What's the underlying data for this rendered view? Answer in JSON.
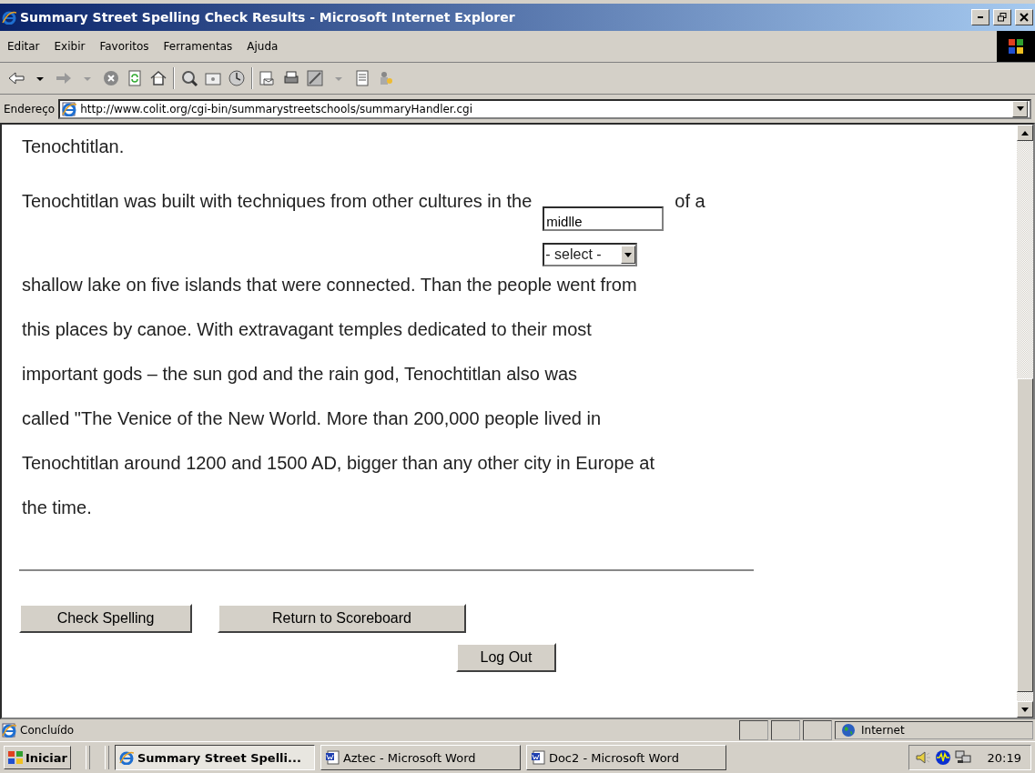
{
  "window": {
    "title": "Summary Street Spelling Check Results - Microsoft Internet Explorer"
  },
  "menu": [
    "Editar",
    "Exibir",
    "Favoritos",
    "Ferramentas",
    "Ajuda"
  ],
  "address": {
    "label": "Endereço",
    "url": "http://www.colit.org/cgi-bin/summarystreetschools/summaryHandler.cgi"
  },
  "page": {
    "lines_before": [
      "Tenochtitlan."
    ],
    "field_line": {
      "before": "Tenochtitlan was built with techniques from other cultures in the",
      "value": "midlle",
      "after": "of a"
    },
    "select": "- select -",
    "lines_after": [
      "shallow lake on five islands that were connected. Than the people went from",
      "this places by canoe. With extravagant temples dedicated to their most",
      "important gods – the sun god and the rain god, Tenochtitlan also was",
      "called \"The Venice of the New World. More than 200,000 people lived in",
      "Tenochtitlan around 1200 and 1500 AD, bigger than any other city in Europe at",
      "the time."
    ],
    "buttons": [
      "Check Spelling",
      "Return to Scoreboard"
    ],
    "logout": "Log Out"
  },
  "status_bar": {
    "text": "Concluído",
    "zone": "Internet"
  },
  "taskbar": {
    "start": "Iniciar",
    "tasks": [
      {
        "label": "Summary Street Spelli...",
        "kind": "ie",
        "selected": true
      },
      {
        "label": "Aztec - Microsoft Word",
        "kind": "word",
        "selected": false
      },
      {
        "label": "Doc2 - Microsoft Word",
        "kind": "word",
        "selected": false
      }
    ],
    "clock": "20:19"
  }
}
